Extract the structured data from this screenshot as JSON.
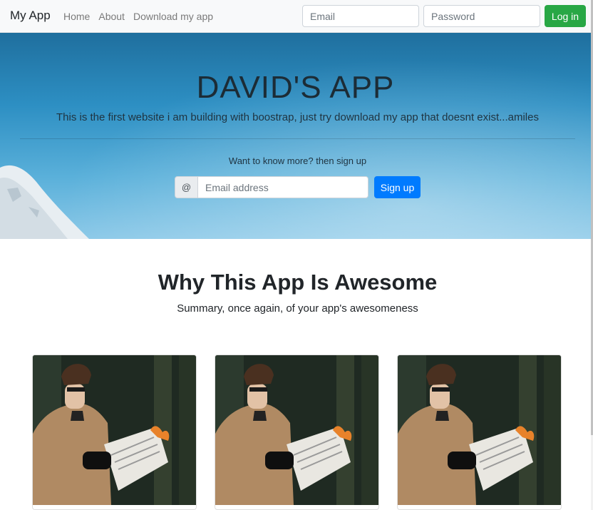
{
  "navbar": {
    "brand": "My App",
    "links": [
      "Home",
      "About",
      "Download my app"
    ],
    "email_placeholder": "Email",
    "password_placeholder": "Password",
    "login_label": "Log in",
    "login_color": "#28a745"
  },
  "hero": {
    "title": "DAVID'S APP",
    "subtitle": "This is the first website i am building with boostrap, just try download my app that doesnt exist...amiles",
    "cta_text": "Want to know more? then sign up",
    "addon_symbol": "@",
    "email_placeholder": "Email address",
    "signup_label": "Sign up",
    "signup_color": "#007bff"
  },
  "features": {
    "title": "Why This App Is Awesome",
    "subtitle": "Summary, once again, of your app's awesomeness",
    "cards": [
      {
        "image_icon": "person-reading-burning-newspaper-photo"
      },
      {
        "image_icon": "person-reading-burning-newspaper-photo"
      },
      {
        "image_icon": "person-reading-burning-newspaper-photo"
      }
    ]
  }
}
